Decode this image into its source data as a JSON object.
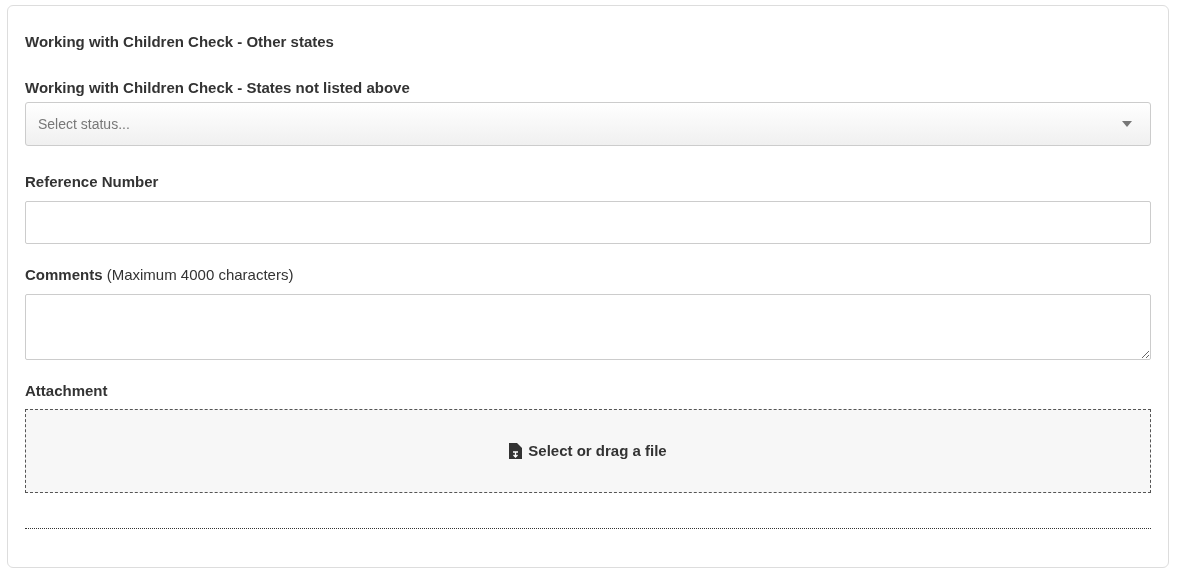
{
  "section_title": "Working with Children Check - Other states",
  "status_field": {
    "label": "Working with Children Check - States not listed above",
    "placeholder": "Select status..."
  },
  "reference_field": {
    "label": "Reference Number"
  },
  "comments_field": {
    "label": "**Comments** (Maximum 4000 characters)"
  },
  "attachment": {
    "label": "Attachment",
    "dropzone_text": "Select or drag a file"
  }
}
